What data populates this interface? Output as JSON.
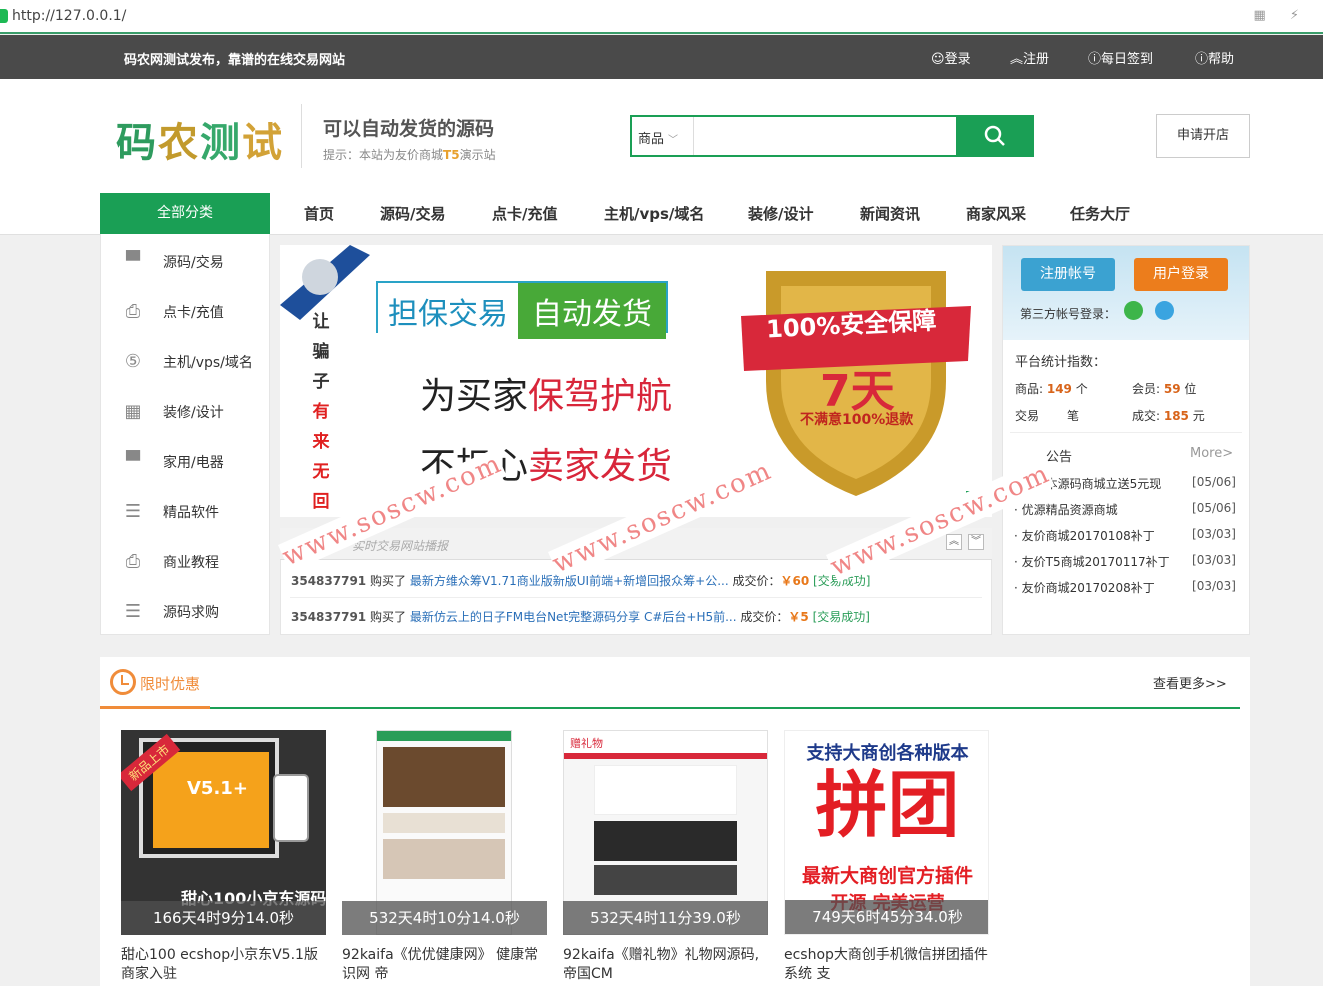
{
  "browser": {
    "url": "http://127.0.0.1/"
  },
  "topbar": {
    "slogan": "码农网测试发布，靠谱的在线交易网站",
    "links": [
      {
        "icon": "user-icon",
        "label": "登录"
      },
      {
        "icon": "chevron-up-icon",
        "label": "注册"
      },
      {
        "icon": "question-circle-icon",
        "label": "每日签到"
      },
      {
        "icon": "question-circle-icon",
        "label": "帮助"
      }
    ]
  },
  "header": {
    "logo_chars": [
      "码",
      "农",
      "测",
      "试"
    ],
    "tagline": "可以自动发货的源码",
    "hint_prefix": "提示：本站为友价商城",
    "hint_brand": "T5",
    "hint_suffix": "演示站",
    "search": {
      "category": "商品",
      "value": ""
    },
    "open_shop": "申请开店"
  },
  "nav": {
    "all_categories": "全部分类",
    "items": [
      "首页",
      "源码/交易",
      "点卡/充值",
      "主机/vps/域名",
      "装修/设计",
      "新闻资讯",
      "商家风采",
      "任务大厅"
    ]
  },
  "sidebar": {
    "items": [
      {
        "icon": "store-icon",
        "label": "源码/交易"
      },
      {
        "icon": "monitor-download-icon",
        "label": "点卡/充值"
      },
      {
        "icon": "circle-5-icon",
        "label": "主机/vps/域名"
      },
      {
        "icon": "grid-icon",
        "label": "装修/设计"
      },
      {
        "icon": "store-icon",
        "label": "家用/电器"
      },
      {
        "icon": "document-list-icon",
        "label": "精品软件"
      },
      {
        "icon": "monitor-download-icon",
        "label": "商业教程"
      },
      {
        "icon": "document-list-icon",
        "label": "源码求购"
      }
    ]
  },
  "banner": {
    "badge1": "担保交易",
    "badge2": "自动发货",
    "vertical": [
      "让",
      "骗",
      "子",
      "有",
      "来",
      "无",
      "回"
    ],
    "line1_a": "为买家",
    "line1_b": "保驾护航",
    "line2_a": "不担心",
    "line2_b": "卖家发货",
    "ribbon": "100%安全保障",
    "days": "7天",
    "refund": "不满意100%退款",
    "page": "2"
  },
  "deals": {
    "title": "交易",
    "subtitle": "实时交易网站播报",
    "rows": [
      {
        "uid": "354837791",
        "bought": "购买了",
        "name": "最新方维众筹V1.71商业版新版UI前端+新增回报众筹+公...",
        "price_label": "成交价：",
        "price": "￥60",
        "status": "[交易成功]"
      },
      {
        "uid": "354837791",
        "bought": "购买了",
        "name": "最新仿云上的日子FM电台Net完整源码分享 C#后台+H5前...",
        "price_label": "成交价：",
        "price": "￥5",
        "status": "[交易成功]"
      }
    ]
  },
  "user_panel": {
    "register": "注册帐号",
    "login": "用户登录",
    "third_party": "第三方帐号登录：",
    "stats_title": "平台统计指数：",
    "stats": [
      {
        "label": "商品: ",
        "value": "149",
        "unit": " 个"
      },
      {
        "label": "会员: ",
        "value": "59",
        "unit": " 位"
      },
      {
        "label": "交易",
        "value": "",
        "unit": "笔"
      },
      {
        "label": "成交: ",
        "value": "185",
        "unit": " 元"
      }
    ],
    "notice_title": "公告",
    "notice_more": "More>",
    "notices": [
      {
        "title": "· 注册本源码商城立送5元现",
        "date": "[05/06]"
      },
      {
        "title": "· 优源精品资源商城",
        "date": "[05/06]"
      },
      {
        "title": "· 友价商城20170108补丁",
        "date": "[03/03]"
      },
      {
        "title": "· 友价T5商城20170117补丁",
        "date": "[03/03]"
      },
      {
        "title": "· 友价商城20170208补丁",
        "date": "[03/03]"
      }
    ]
  },
  "flash_sale": {
    "title": "限时优惠",
    "more": "查看更多>>",
    "products": [
      {
        "countdown": "166天4时9分14.0秒",
        "title": "甜心100 ecshop小京东V5.1版商家入驻",
        "img_text": "甜心100小京东源码",
        "tag": "新品上市",
        "ver": "V5.1+"
      },
      {
        "countdown": "532天4时10分14.0秒",
        "title": "92kaifa《优优健康网》 健康常识网 帝"
      },
      {
        "countdown": "532天4时11分39.0秒",
        "title": "92kaifa《赠礼物》礼物网源码,帝国CM",
        "img_text": "赠礼物"
      },
      {
        "countdown": "749天6时45分34.0秒",
        "title": "ecshop大商创手机微信拼团插件 系统 支",
        "img_line1": "支持大商创各种版本",
        "img_big": "拼团",
        "img_line2": "最新大商创官方插件",
        "img_line3": "开源 完美运营"
      }
    ]
  },
  "watermarks": [
    "www.soscw.com",
    "www.soscw.com",
    "www.soscw.com"
  ],
  "colors": {
    "brand_green": "#1a9f55",
    "orange": "#ec7d1c",
    "topbar": "#4a4a4a",
    "price": "#e8781a"
  }
}
